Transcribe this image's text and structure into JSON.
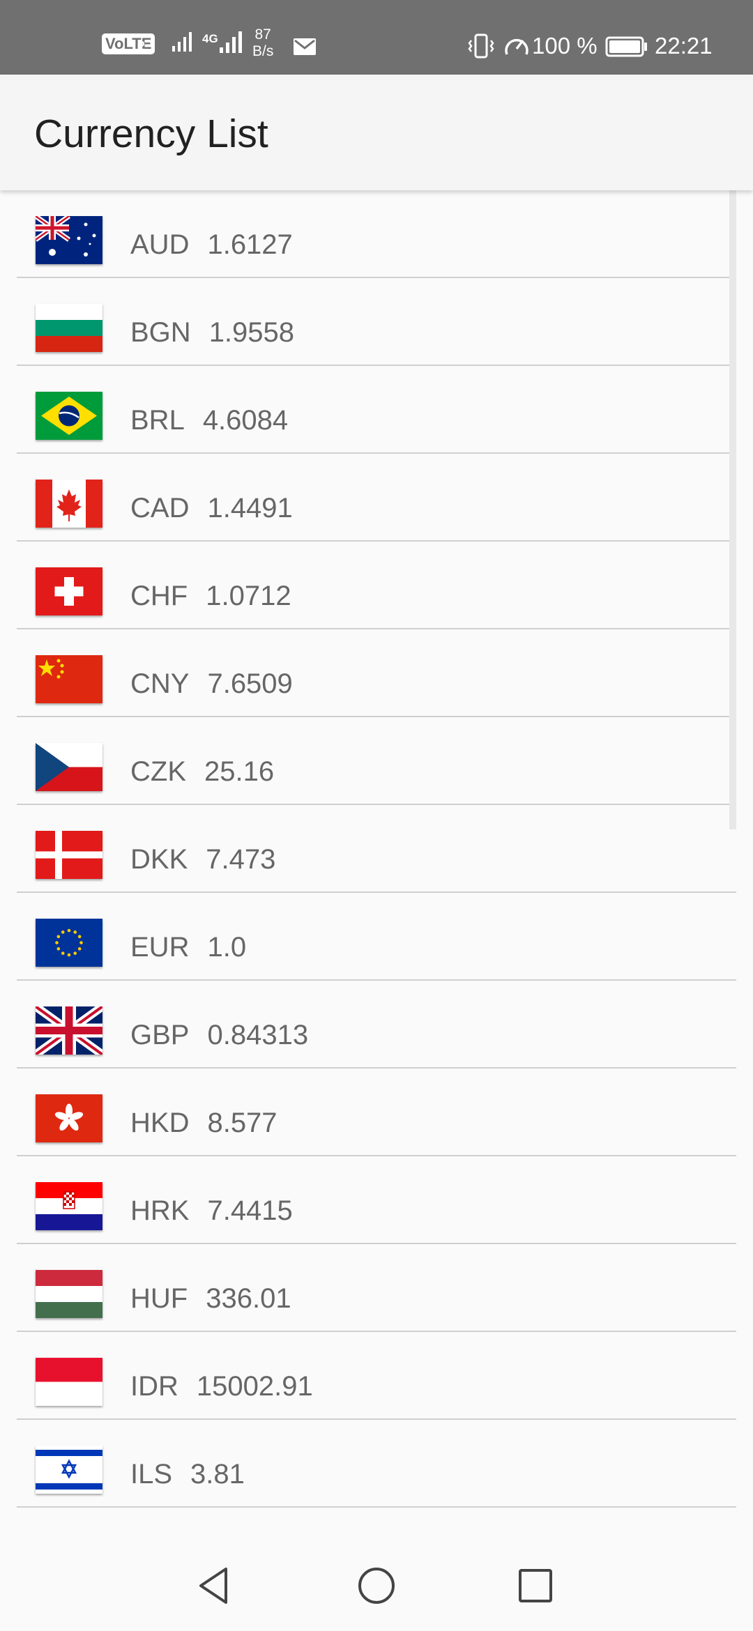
{
  "status_bar": {
    "volte": "VoLTE",
    "sim": "2",
    "network": "4G",
    "speed_value": "87",
    "speed_unit": "B/s",
    "battery_pct": "100 %",
    "time": "22:21",
    "icons": [
      "signal-icon",
      "mail-icon",
      "vibrate-icon",
      "gauge-icon",
      "battery-icon"
    ]
  },
  "app_bar": {
    "title": "Currency List"
  },
  "currencies": [
    {
      "code": "AUD",
      "rate": "1.6127",
      "flag": "australia-flag-icon"
    },
    {
      "code": "BGN",
      "rate": "1.9558",
      "flag": "bulgaria-flag-icon"
    },
    {
      "code": "BRL",
      "rate": "4.6084",
      "flag": "brazil-flag-icon"
    },
    {
      "code": "CAD",
      "rate": "1.4491",
      "flag": "canada-flag-icon"
    },
    {
      "code": "CHF",
      "rate": "1.0712",
      "flag": "switzerland-flag-icon"
    },
    {
      "code": "CNY",
      "rate": "7.6509",
      "flag": "china-flag-icon"
    },
    {
      "code": "CZK",
      "rate": "25.16",
      "flag": "czech-flag-icon"
    },
    {
      "code": "DKK",
      "rate": "7.473",
      "flag": "denmark-flag-icon"
    },
    {
      "code": "EUR",
      "rate": "1.0",
      "flag": "eu-flag-icon"
    },
    {
      "code": "GBP",
      "rate": "0.84313",
      "flag": "uk-flag-icon"
    },
    {
      "code": "HKD",
      "rate": "8.577",
      "flag": "hong-kong-flag-icon"
    },
    {
      "code": "HRK",
      "rate": "7.4415",
      "flag": "croatia-flag-icon"
    },
    {
      "code": "HUF",
      "rate": "336.01",
      "flag": "hungary-flag-icon"
    },
    {
      "code": "IDR",
      "rate": "15002.91",
      "flag": "indonesia-flag-icon"
    },
    {
      "code": "ILS",
      "rate": "3.81",
      "flag": "israel-flag-icon"
    }
  ],
  "nav_bar": {
    "icons": [
      "back-icon",
      "home-icon",
      "recents-icon"
    ]
  },
  "colors": {
    "status_bar": "#707070",
    "app_bar": "#f5f5f5",
    "background": "#fafafa",
    "title_text": "#212121",
    "row_text": "#666666",
    "divider": "#cfcfcf"
  }
}
